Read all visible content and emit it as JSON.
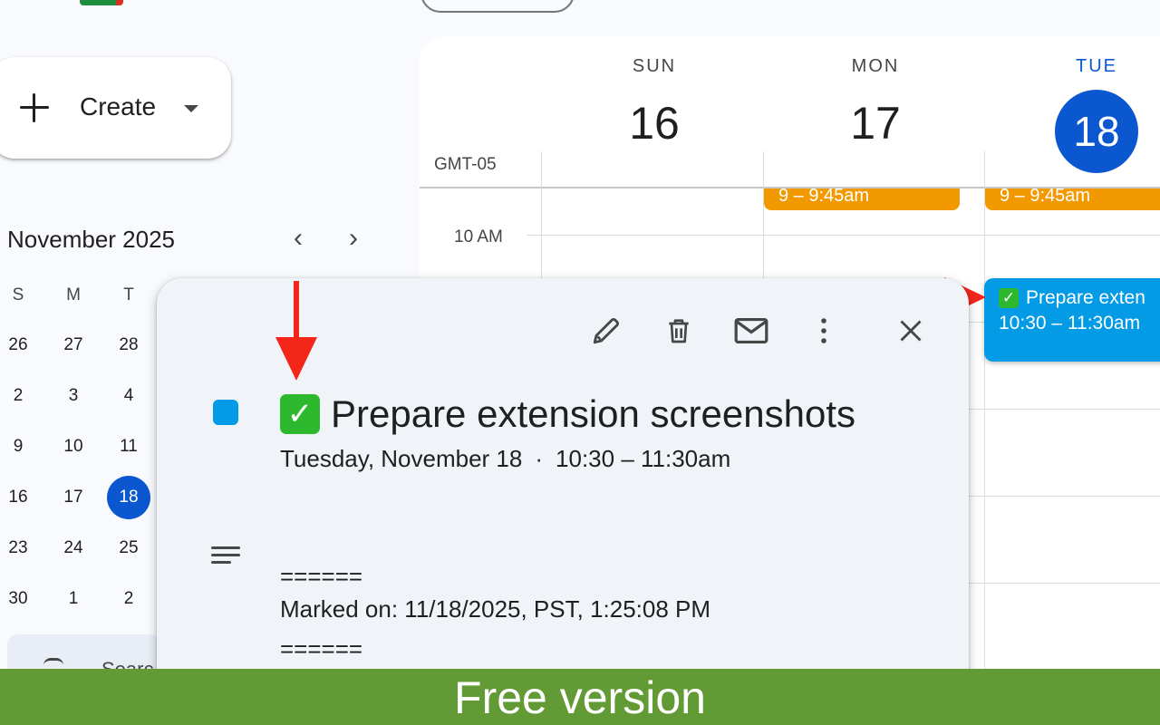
{
  "app": {
    "brand_colors": {
      "green": "#1e8e3e",
      "red": "#d93025"
    }
  },
  "create": {
    "label": "Create",
    "icon": "plus-icon",
    "caret_icon": "caret-down-icon"
  },
  "mini_calendar": {
    "title": "November 2025",
    "prev_icon": "chevron-left-icon",
    "next_icon": "chevron-right-icon",
    "weekday_headers": [
      "S",
      "M",
      "T"
    ],
    "rows": [
      [
        "26",
        "27",
        "28"
      ],
      [
        "2",
        "3",
        "4"
      ],
      [
        "9",
        "10",
        "11"
      ],
      [
        "16",
        "17",
        "18"
      ],
      [
        "23",
        "24",
        "25"
      ],
      [
        "30",
        "1",
        "2"
      ]
    ],
    "today": "18"
  },
  "search_people": {
    "label": "Searc"
  },
  "week_view": {
    "timezone": "GMT-05",
    "days": [
      {
        "dow": "SUN",
        "num": "16"
      },
      {
        "dow": "MON",
        "num": "17"
      },
      {
        "dow": "TUE",
        "num": "18"
      }
    ],
    "time_labels": [
      "10 AM"
    ],
    "orange_events": [
      {
        "time": "9 – 9:45am"
      },
      {
        "time": "9 – 9:45am"
      }
    ],
    "blue_event": {
      "title": "Prepare exten",
      "time": "10:30 – 11:30am"
    },
    "colors": {
      "today": "#0b57d0",
      "event_orange": "#f29900",
      "event_blue": "#039be5"
    }
  },
  "popup": {
    "icons": [
      "pencil-icon",
      "trash-icon",
      "mail-icon",
      "more-vert-icon",
      "close-icon"
    ],
    "title": "Prepare extension screenshots",
    "date": "Tuesday, November 18",
    "separator": "·",
    "time": "10:30 – 11:30am",
    "description": [
      "======",
      "Marked on: 11/18/2025, PST, 1:25:08 PM",
      "======"
    ],
    "check_glyph": "✓"
  },
  "annotations": {
    "arrow_color": "#f4261a"
  },
  "footer": {
    "label": "Free version",
    "color": "#629a36"
  }
}
